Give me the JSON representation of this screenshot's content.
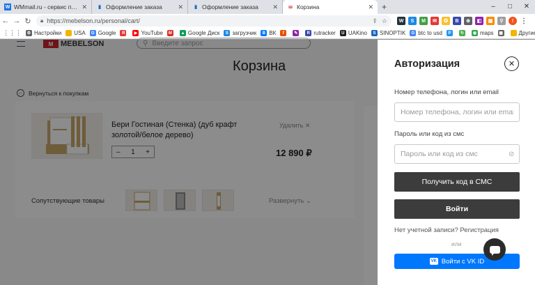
{
  "browser": {
    "tabs": [
      {
        "title": "WMmail.ru - сервис почтовых ра",
        "favicon": "wm-icon",
        "active": false
      },
      {
        "title": "Оформление заказа",
        "favicon": "mebelson-icon",
        "active": false
      },
      {
        "title": "Оформление заказа",
        "favicon": "mebelson-icon",
        "active": false
      },
      {
        "title": "Корзина",
        "favicon": "mebelson-icon",
        "active": true
      }
    ],
    "new_tab": "+",
    "window_controls": [
      "–",
      "□",
      "✕"
    ],
    "url": "https://mebelson.ru/personal/cart/",
    "bookmarks": [
      {
        "label": "Настройки",
        "color": "#5f6368",
        "glyph": "⚙"
      },
      {
        "label": "USA",
        "color": "#f4b400",
        "glyph": ""
      },
      {
        "label": "Google",
        "color": "#4285f4",
        "glyph": "G"
      },
      {
        "label": "",
        "color": "#e53935",
        "glyph": "Я"
      },
      {
        "label": "YouTube",
        "color": "#ff0000",
        "glyph": "▶"
      },
      {
        "label": "",
        "color": "#d93025",
        "glyph": "M"
      },
      {
        "label": "Google Диск",
        "color": "#0f9d58",
        "glyph": "▲"
      },
      {
        "label": "загрузчик",
        "color": "#1e88e5",
        "glyph": "S"
      },
      {
        "label": "ВК",
        "color": "#0077ff",
        "glyph": "В"
      },
      {
        "label": "",
        "color": "#e65100",
        "glyph": "f"
      },
      {
        "label": "",
        "color": "#8e24aa",
        "glyph": "✎"
      },
      {
        "label": "rutracker",
        "color": "#3949ab",
        "glyph": "R"
      },
      {
        "label": "UAKino",
        "color": "#212121",
        "glyph": "U"
      },
      {
        "label": "SINOPTIK",
        "color": "#1565c0",
        "glyph": "S"
      },
      {
        "label": "btc to usd",
        "color": "#4285f4",
        "glyph": "G"
      },
      {
        "label": "",
        "color": "#2196f3",
        "glyph": "P"
      },
      {
        "label": "",
        "color": "#4caf50",
        "glyph": "↻"
      },
      {
        "label": "maps",
        "color": "#34a853",
        "glyph": "◉"
      },
      {
        "label": "",
        "color": "#616161",
        "glyph": "▦"
      }
    ],
    "other_bookmarks": "Другие закладки"
  },
  "site": {
    "logo_text": "MEBELSON",
    "logo_mark": "M",
    "search_placeholder": "Введите запрос",
    "cart_title": "Корзина",
    "back_link": "Вернуться к покупкам",
    "product": {
      "name": "Бери Гостиная (Стенка) (дуб крафт золотой/белое дерево)",
      "remove_label": "Удалить ✕",
      "quantity": "1",
      "price": "12 890 ₽"
    },
    "related_label": "Сопутствующие товары",
    "expand_label": "Развернуть"
  },
  "auth": {
    "title": "Авторизация",
    "login_label": "Номер телефона, логин или email",
    "login_placeholder": "Номер телефона, логин или email",
    "password_label": "Пароль или код из смс",
    "password_placeholder": "Пароль или код из смс",
    "sms_button": "Получить код в СМС",
    "login_button": "Войти",
    "register_text": "Нет учетной записи? Регистрация",
    "or_text": "или",
    "vk_button": "Войти с VK ID",
    "vk_icon": "vk"
  },
  "colors": {
    "accent_red": "#c8262c",
    "dark_button": "#3c3c3c",
    "vk_blue": "#0077ff"
  }
}
